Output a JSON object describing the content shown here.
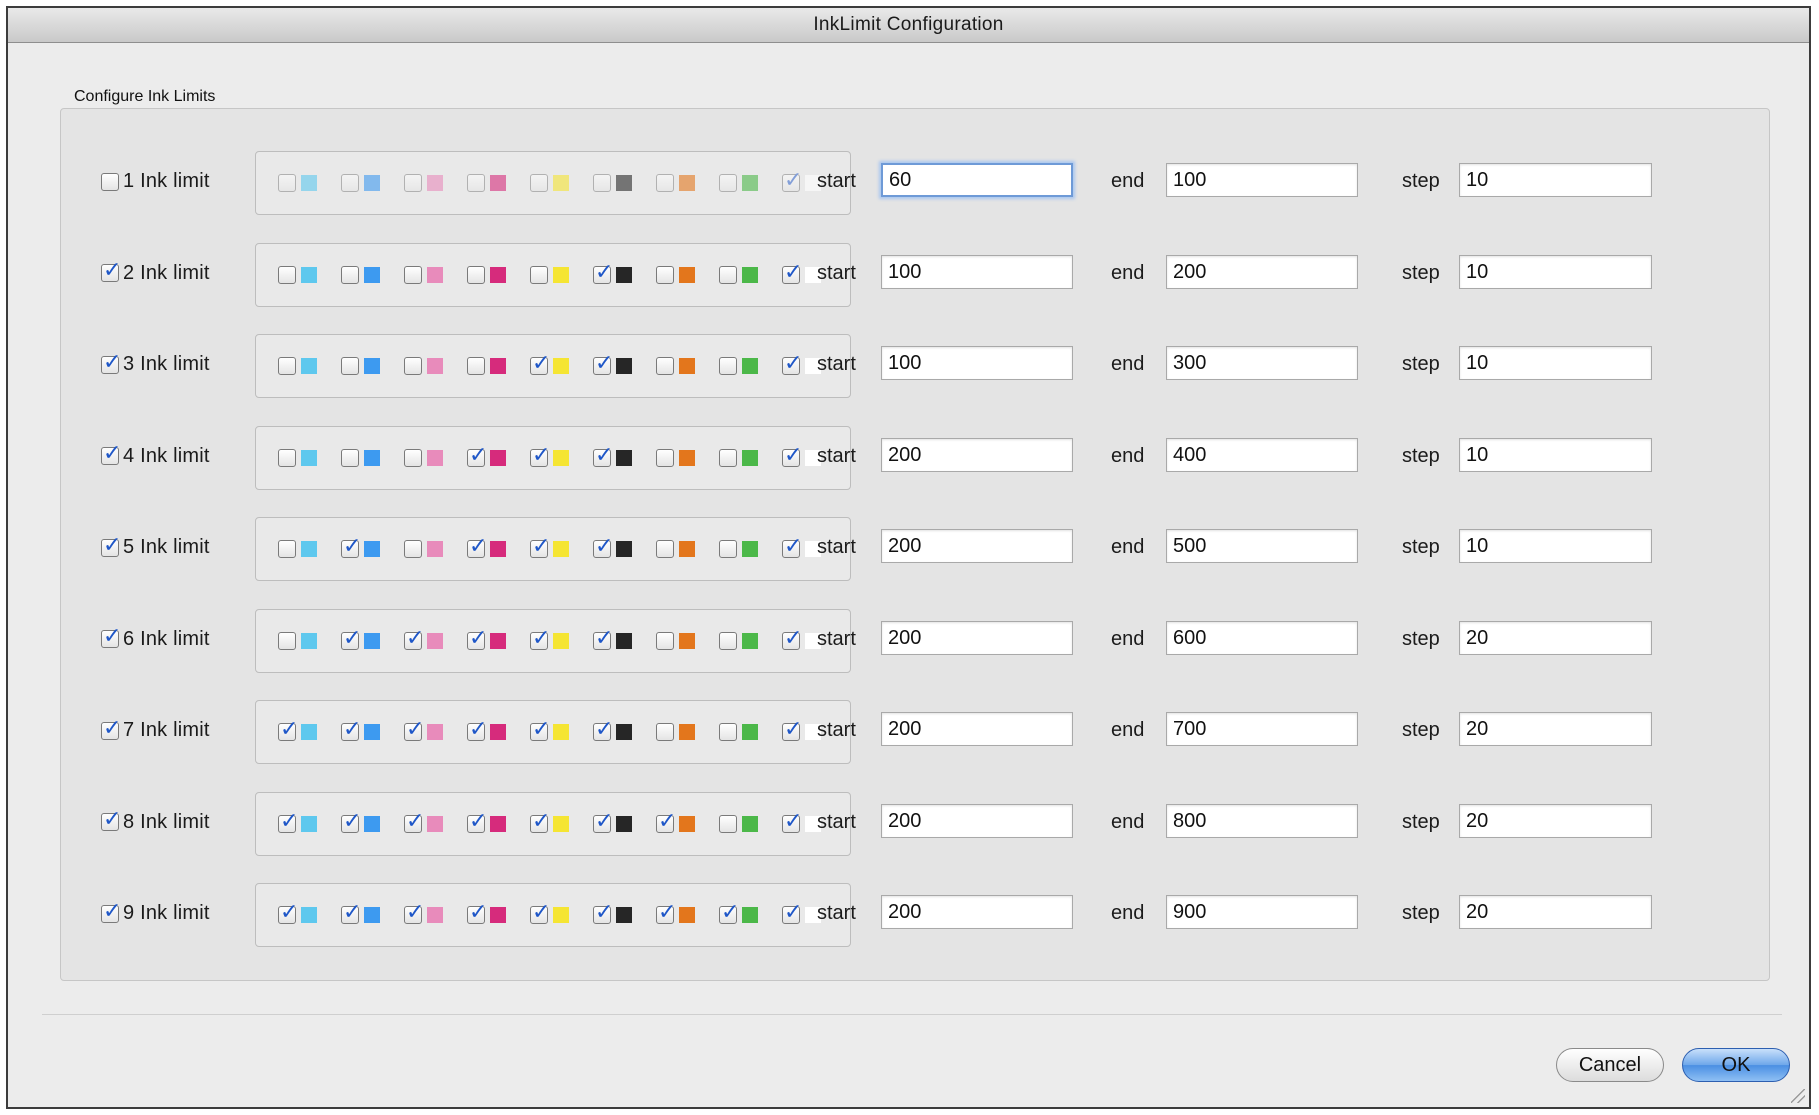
{
  "window": {
    "title": "InkLimit Configuration"
  },
  "group": {
    "label": "Configure Ink Limits"
  },
  "labels": {
    "start": "start",
    "end": "end",
    "step": "step"
  },
  "ink_colors": [
    "#5ec8ee",
    "#3d9af0",
    "#e88bbb",
    "#d62b7c",
    "#f5e533",
    "#262626",
    "#e3761c",
    "#4cb849",
    "#ffffff"
  ],
  "rows": [
    {
      "label": "1 Ink limit",
      "enabled": false,
      "inks": [
        false,
        false,
        false,
        false,
        false,
        false,
        false,
        false,
        true
      ],
      "start": "60",
      "end": "100",
      "step": "10"
    },
    {
      "label": "2 Ink limit",
      "enabled": true,
      "inks": [
        false,
        false,
        false,
        false,
        false,
        true,
        false,
        false,
        true
      ],
      "start": "100",
      "end": "200",
      "step": "10"
    },
    {
      "label": "3 Ink limit",
      "enabled": true,
      "inks": [
        false,
        false,
        false,
        false,
        true,
        true,
        false,
        false,
        true
      ],
      "start": "100",
      "end": "300",
      "step": "10"
    },
    {
      "label": "4 Ink limit",
      "enabled": true,
      "inks": [
        false,
        false,
        false,
        true,
        true,
        true,
        false,
        false,
        true
      ],
      "start": "200",
      "end": "400",
      "step": "10"
    },
    {
      "label": "5 Ink limit",
      "enabled": true,
      "inks": [
        false,
        true,
        false,
        true,
        true,
        true,
        false,
        false,
        true
      ],
      "start": "200",
      "end": "500",
      "step": "10"
    },
    {
      "label": "6 Ink limit",
      "enabled": true,
      "inks": [
        false,
        true,
        true,
        true,
        true,
        true,
        false,
        false,
        true
      ],
      "start": "200",
      "end": "600",
      "step": "20"
    },
    {
      "label": "7 Ink limit",
      "enabled": true,
      "inks": [
        true,
        true,
        true,
        true,
        true,
        true,
        false,
        false,
        true
      ],
      "start": "200",
      "end": "700",
      "step": "20"
    },
    {
      "label": "8 Ink limit",
      "enabled": true,
      "inks": [
        true,
        true,
        true,
        true,
        true,
        true,
        true,
        false,
        true
      ],
      "start": "200",
      "end": "800",
      "step": "20"
    },
    {
      "label": "9 Ink limit",
      "enabled": true,
      "inks": [
        true,
        true,
        true,
        true,
        true,
        true,
        true,
        true,
        true
      ],
      "start": "200",
      "end": "900",
      "step": "20"
    }
  ],
  "buttons": {
    "cancel": "Cancel",
    "ok": "OK"
  }
}
